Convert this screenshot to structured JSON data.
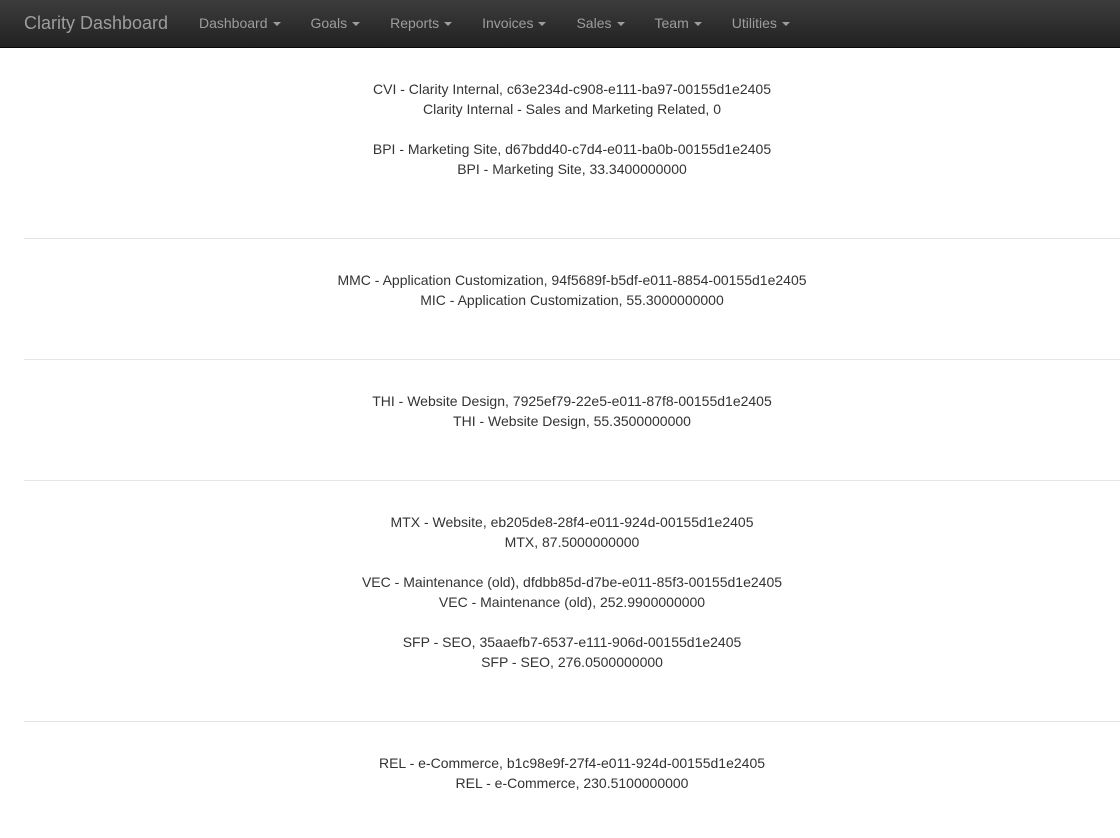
{
  "navbar": {
    "brand": "Clarity Dashboard",
    "items": [
      {
        "label": "Dashboard"
      },
      {
        "label": "Goals"
      },
      {
        "label": "Reports"
      },
      {
        "label": "Invoices"
      },
      {
        "label": "Sales"
      },
      {
        "label": "Team"
      },
      {
        "label": "Utilities"
      }
    ]
  },
  "groups": [
    {
      "entries": [
        {
          "line1": "CVI - Clarity Internal, c63e234d-c908-e111-ba97-00155d1e2405",
          "line2": "Clarity Internal - Sales and Marketing Related, 0"
        },
        {
          "line1": "BPI - Marketing Site, d67bdd40-c7d4-e011-ba0b-00155d1e2405",
          "line2": "BPI - Marketing Site, 33.3400000000"
        }
      ]
    },
    {
      "entries": [
        {
          "line1": "MMC - Application Customization, 94f5689f-b5df-e011-8854-00155d1e2405",
          "line2": "MIC - Application Customization, 55.3000000000"
        }
      ]
    },
    {
      "entries": [
        {
          "line1": "THI - Website Design, 7925ef79-22e5-e011-87f8-00155d1e2405",
          "line2": "THI - Website Design, 55.3500000000"
        }
      ]
    },
    {
      "entries": [
        {
          "line1": "MTX - Website, eb205de8-28f4-e011-924d-00155d1e2405",
          "line2": "MTX, 87.5000000000"
        },
        {
          "line1": "VEC - Maintenance (old), dfdbb85d-d7be-e011-85f3-00155d1e2405",
          "line2": "VEC - Maintenance (old), 252.9900000000"
        },
        {
          "line1": "SFP - SEO, 35aaefb7-6537-e111-906d-00155d1e2405",
          "line2": "SFP - SEO, 276.0500000000"
        }
      ]
    },
    {
      "entries": [
        {
          "line1": "REL - e-Commerce, b1c98e9f-27f4-e011-924d-00155d1e2405",
          "line2": "REL - e-Commerce, 230.5100000000"
        }
      ]
    }
  ]
}
